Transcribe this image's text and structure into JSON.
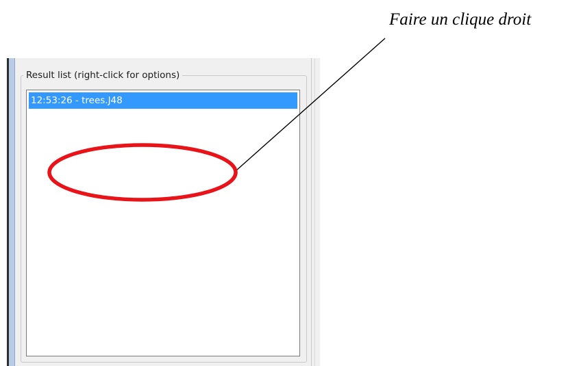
{
  "result_panel": {
    "group_title": "Result list (right-click for options)",
    "items": [
      {
        "label": "12:53:26 - trees.J48",
        "selected": true
      }
    ]
  },
  "annotation": {
    "text": "Faire un clique droit",
    "ellipse_color": "#e8141a",
    "line_color": "#000000"
  },
  "colors": {
    "selection": "#3399ff",
    "panel_background": "#f0f0f0",
    "window_strip": "#b9cbe6"
  }
}
